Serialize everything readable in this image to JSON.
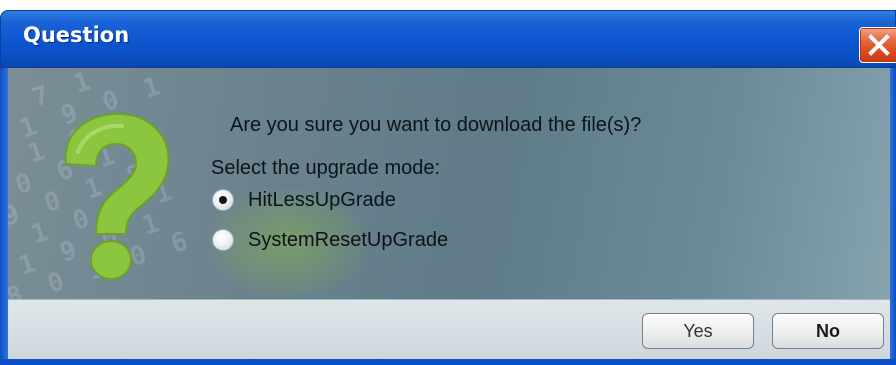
{
  "window": {
    "title": "Question",
    "close_icon": "close-icon"
  },
  "dialog": {
    "icon": "question-mark-icon",
    "message": "Are you sure you want to download the file(s)?",
    "mode_label": "Select the upgrade mode:",
    "options": [
      {
        "label": "HitLessUpGrade",
        "selected": true
      },
      {
        "label": "SystemResetUpGrade",
        "selected": false
      }
    ]
  },
  "buttons": {
    "yes_label": "Yes",
    "no_label": "No"
  },
  "colors": {
    "titlebar": "#0d55cf",
    "close_button": "#d9491c",
    "content_background": "#6a828e",
    "question_icon": "#8cc63f",
    "button_bar": "#d5dee3"
  }
}
